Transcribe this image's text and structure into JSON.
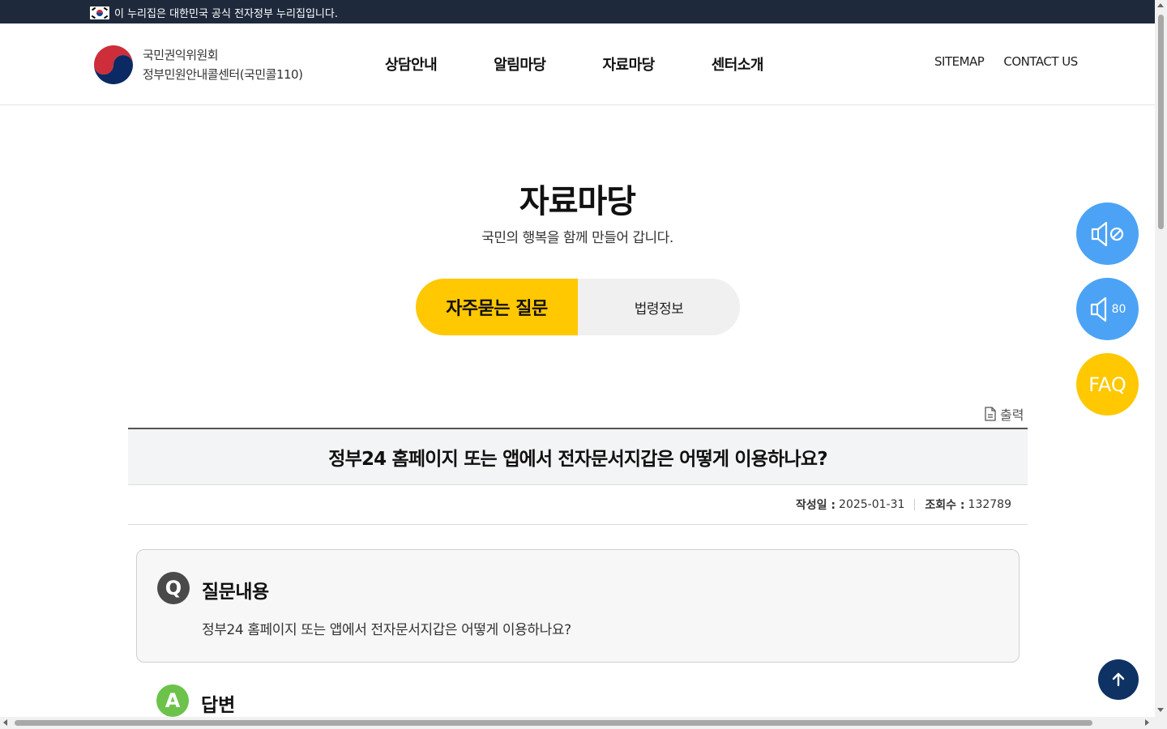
{
  "gov_banner": {
    "text": "이 누리집은 대한민국 공식 전자정부 누리집입니다.",
    "icon": "korea-flag-icon"
  },
  "header": {
    "logo": {
      "line1": "국민권익위원회",
      "line2": "정부민원안내콜센터(국민콜110)",
      "icon": "government-emblem-icon"
    },
    "nav": [
      {
        "label": "상담안내"
      },
      {
        "label": "알림마당"
      },
      {
        "label": "자료마당"
      },
      {
        "label": "센터소개"
      }
    ],
    "util": {
      "sitemap": "SITEMAP",
      "contact": "CONTACT US"
    }
  },
  "page_head": {
    "title": "자료마당",
    "subtitle": "국민의 행복을 함께 만들어 갑니다."
  },
  "tabs": [
    {
      "label": "자주묻는 질문",
      "active": true
    },
    {
      "label": "법령정보",
      "active": false
    }
  ],
  "print": {
    "label": "출력",
    "icon": "document-icon"
  },
  "article": {
    "title": "정부24 홈페이지 또는 앱에서 전자문서지갑은 어떻게 이용하나요?",
    "meta": {
      "date_label": "작성일 :",
      "date": "2025-01-31",
      "views_label": "조회수 :",
      "views": "132789"
    }
  },
  "question": {
    "badge": "Q",
    "heading": "질문내용",
    "body": "정부24 홈페이지 또는 앱에서 전자문서지갑은 어떻게 이용하나요?"
  },
  "answer": {
    "badge": "A",
    "heading": "답변"
  },
  "floating": {
    "mute_icon": "speaker-mute-icon",
    "volume_icon": "speaker-volume-icon",
    "volume_value": "80",
    "faq_label": "FAQ",
    "top_icon": "arrow-up-icon"
  },
  "colors": {
    "banner_bg": "#1e2a3c",
    "accent_yellow": "#ffc800",
    "accent_blue": "#4ca3f5",
    "top_button": "#0e3263",
    "answer_green": "#6cc24a",
    "question_gray": "#4a4a4a"
  }
}
